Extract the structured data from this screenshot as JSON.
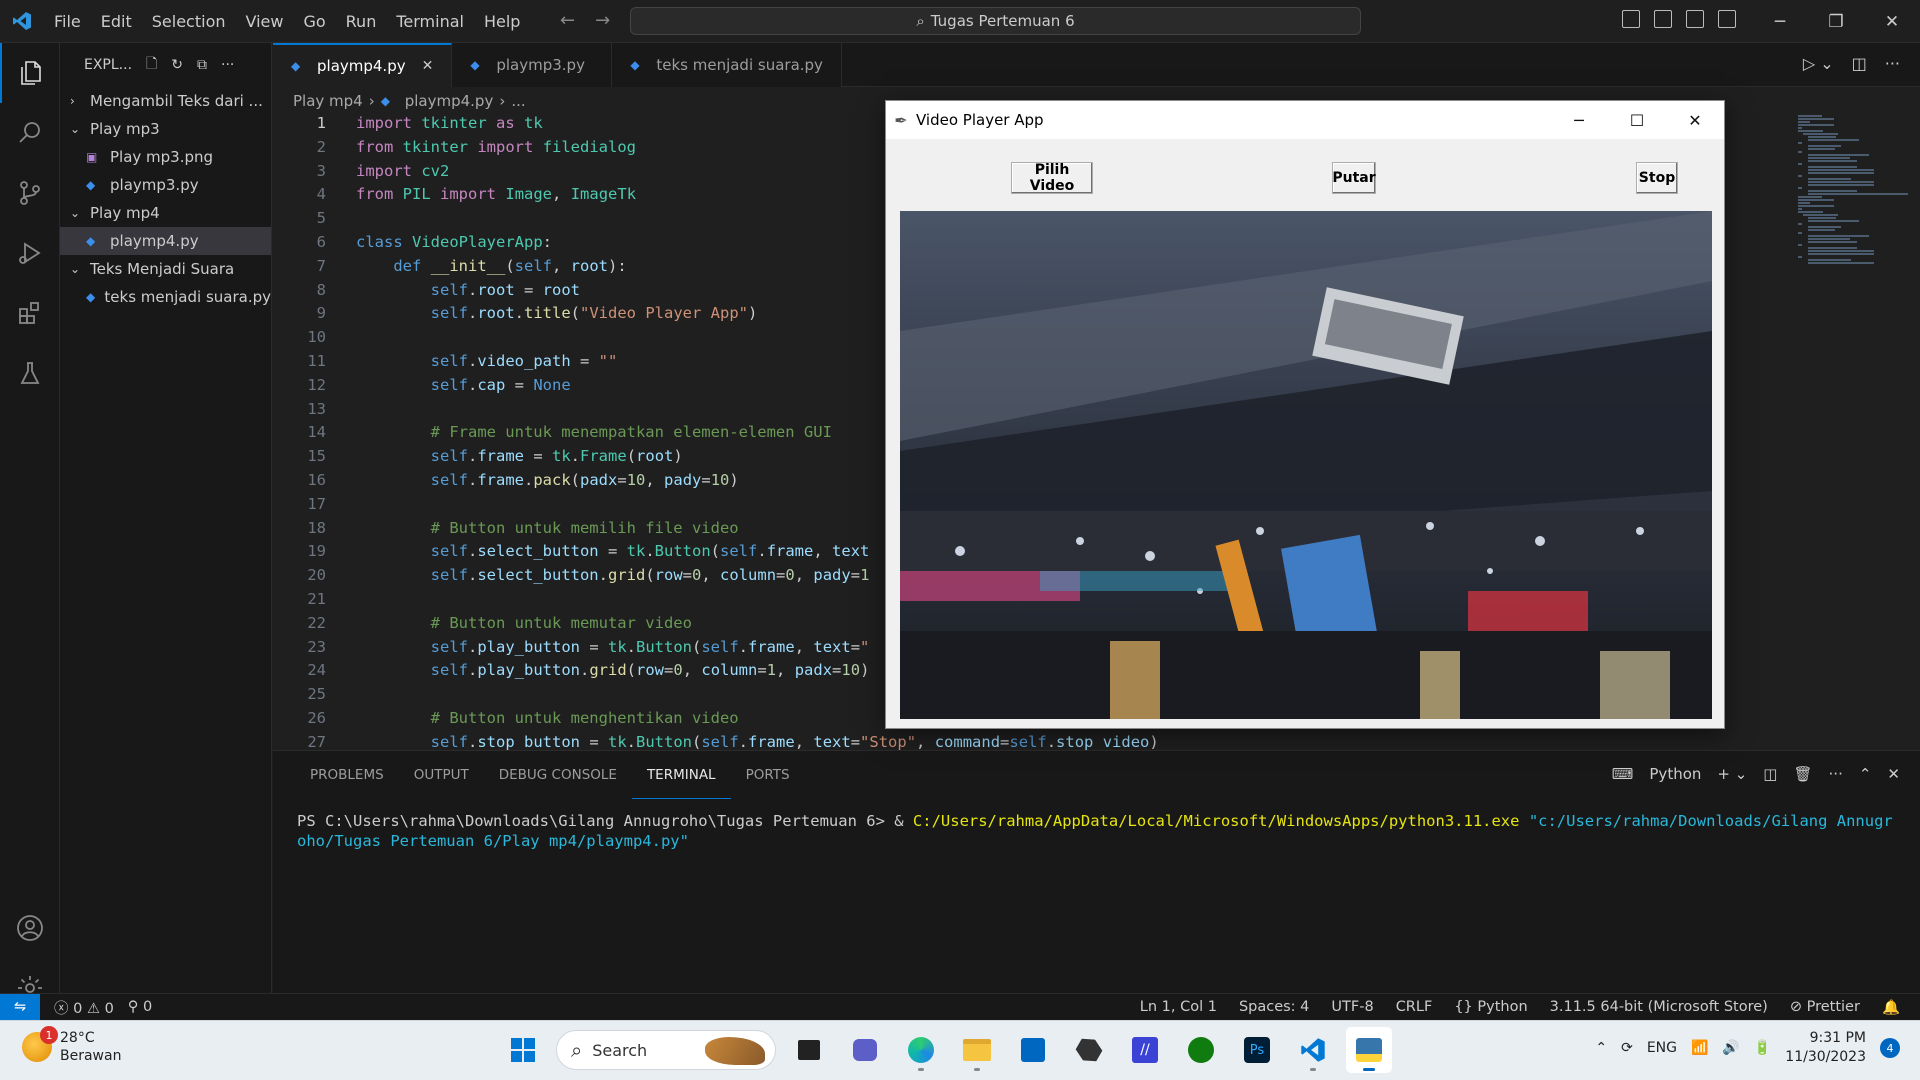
{
  "titlebar": {
    "menu": [
      "File",
      "Edit",
      "Selection",
      "View",
      "Go",
      "Run",
      "Terminal",
      "Help"
    ],
    "search_text": "Tugas Pertemuan 6"
  },
  "sidebar": {
    "header": "EXPL...",
    "items": [
      {
        "label": "Mengambil Teks dari ...",
        "type": "folder",
        "open": false
      },
      {
        "label": "Play mp3",
        "type": "folder",
        "open": true
      },
      {
        "label": "Play mp3.png",
        "type": "image"
      },
      {
        "label": "playmp3.py",
        "type": "python"
      },
      {
        "label": "Play mp4",
        "type": "folder",
        "open": true
      },
      {
        "label": "playmp4.py",
        "type": "python",
        "selected": true
      },
      {
        "label": "Teks Menjadi Suara",
        "type": "folder",
        "open": true
      },
      {
        "label": "teks menjadi suara.py",
        "type": "python"
      }
    ]
  },
  "tabs": [
    {
      "label": "playmp4.py",
      "active": true
    },
    {
      "label": "playmp3.py",
      "active": false
    },
    {
      "label": "teks menjadi suara.py",
      "active": false
    }
  ],
  "breadcrumb": {
    "folder": "Play mp4",
    "file": "playmp4.py",
    "more": "..."
  },
  "code_lines": [
    "import tkinter as tk",
    "from tkinter import filedialog",
    "import cv2",
    "from PIL import Image, ImageTk",
    "",
    "class VideoPlayerApp:",
    "    def __init__(self, root):",
    "        self.root = root",
    "        self.root.title(\"Video Player App\")",
    "",
    "        self.video_path = \"\"",
    "        self.cap = None",
    "",
    "        # Frame untuk menempatkan elemen-elemen GUI",
    "        self.frame = tk.Frame(root)",
    "        self.frame.pack(padx=10, pady=10)",
    "",
    "        # Button untuk memilih file video",
    "        self.select_button = tk.Button(self.frame, text",
    "        self.select_button.grid(row=0, column=0, pady=1",
    "",
    "        # Button untuk memutar video",
    "        self.play_button = tk.Button(self.frame, text=\"",
    "        self.play_button.grid(row=0, column=1, padx=10)",
    "",
    "        # Button untuk menghentikan video",
    "        self.stop_button = tk.Button(self.frame, text=\"Stop\", command=self.stop_video)"
  ],
  "panel": {
    "tabs": [
      "PROBLEMS",
      "OUTPUT",
      "DEBUG CONSOLE",
      "TERMINAL",
      "PORTS"
    ],
    "active_tab": "TERMINAL",
    "shell_label": "Python",
    "terminal": {
      "prompt": "PS C:\\Users\\rahma\\Downloads\\Gilang Annugroho\\Tugas Pertemuan 6> & ",
      "exe": "C:/Users/rahma/AppData/Local/Microsoft/WindowsApps/python3.11.exe",
      "arg": " \"c:/Users/rahma/Downloads/Gilang Annugroho/Tugas Pertemuan 6/Play mp4/playmp4.py\""
    }
  },
  "statusbar": {
    "errors": "0",
    "warnings": "0",
    "ports": "0",
    "position": "Ln 1, Col 1",
    "spaces": "Spaces: 4",
    "encoding": "UTF-8",
    "eol": "CRLF",
    "language": "Python",
    "interpreter": "3.11.5 64-bit (Microsoft Store)",
    "formatter": "Prettier"
  },
  "video_app": {
    "title": "Video Player App",
    "buttons": {
      "select": "Pilih Video",
      "play": "Putar",
      "stop": "Stop"
    }
  },
  "taskbar": {
    "weather_temp": "28°C",
    "weather_desc": "Berawan",
    "weather_badge": "1",
    "search_label": "Search",
    "lang": "ENG",
    "time": "9:31 PM",
    "date": "11/30/2023",
    "notifications": "4"
  },
  "colors": {
    "accent": "#0078d4",
    "editor_bg": "#1f1f1f",
    "sidebar_bg": "#181818"
  }
}
